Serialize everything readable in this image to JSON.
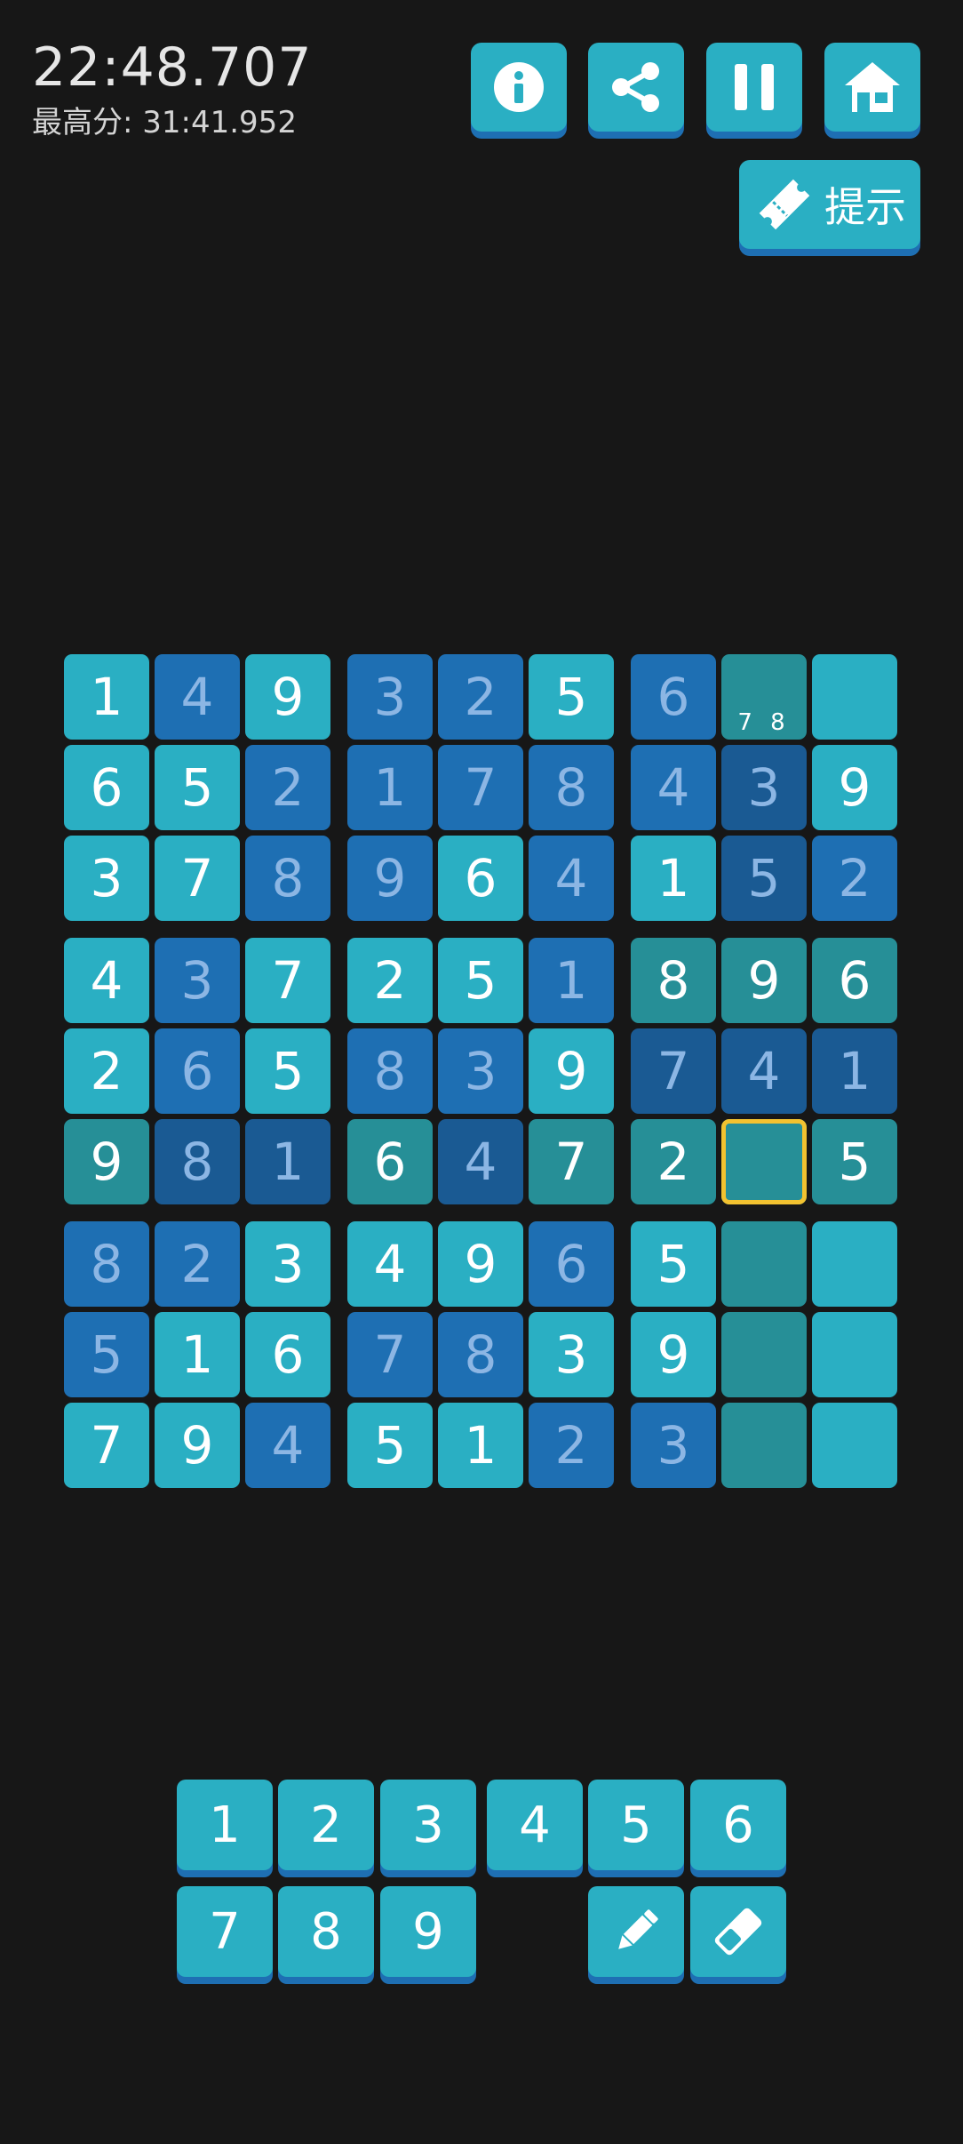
{
  "timer": "22:48.707",
  "best_score": "最高分: 31:41.952",
  "toolbar": {
    "info_icon": "info-circle-icon",
    "share_icon": "share-icon",
    "pause_icon": "pause-icon",
    "home_icon": "home-icon",
    "hint_label": "提示"
  },
  "colors": {
    "given": "#2aafc3",
    "entered": "#1e6fb3",
    "entered_dark": "#1a5a93",
    "highlight": "#268f97",
    "selected_border": "#f2c230",
    "background": "#171717"
  },
  "board": {
    "rows": [
      [
        {
          "v": "1",
          "k": "a"
        },
        {
          "v": "4",
          "k": "b"
        },
        {
          "v": "9",
          "k": "a"
        },
        {
          "v": "3",
          "k": "b"
        },
        {
          "v": "2",
          "k": "b"
        },
        {
          "v": "5",
          "k": "a"
        },
        {
          "v": "6",
          "k": "b"
        },
        {
          "v": "",
          "k": "t",
          "notes": "7 8"
        },
        {
          "v": "",
          "k": "a"
        }
      ],
      [
        {
          "v": "6",
          "k": "a"
        },
        {
          "v": "5",
          "k": "a"
        },
        {
          "v": "2",
          "k": "b"
        },
        {
          "v": "1",
          "k": "b"
        },
        {
          "v": "7",
          "k": "b"
        },
        {
          "v": "8",
          "k": "b"
        },
        {
          "v": "4",
          "k": "b"
        },
        {
          "v": "3",
          "k": "bd"
        },
        {
          "v": "9",
          "k": "a"
        }
      ],
      [
        {
          "v": "3",
          "k": "a"
        },
        {
          "v": "7",
          "k": "a"
        },
        {
          "v": "8",
          "k": "b"
        },
        {
          "v": "9",
          "k": "b"
        },
        {
          "v": "6",
          "k": "a"
        },
        {
          "v": "4",
          "k": "b"
        },
        {
          "v": "1",
          "k": "a"
        },
        {
          "v": "5",
          "k": "bd"
        },
        {
          "v": "2",
          "k": "b"
        }
      ],
      [
        {
          "v": "4",
          "k": "a"
        },
        {
          "v": "3",
          "k": "b"
        },
        {
          "v": "7",
          "k": "a"
        },
        {
          "v": "2",
          "k": "a"
        },
        {
          "v": "5",
          "k": "a"
        },
        {
          "v": "1",
          "k": "b"
        },
        {
          "v": "8",
          "k": "t"
        },
        {
          "v": "9",
          "k": "t"
        },
        {
          "v": "6",
          "k": "t"
        }
      ],
      [
        {
          "v": "2",
          "k": "a"
        },
        {
          "v": "6",
          "k": "b"
        },
        {
          "v": "5",
          "k": "a"
        },
        {
          "v": "8",
          "k": "b"
        },
        {
          "v": "3",
          "k": "b"
        },
        {
          "v": "9",
          "k": "a"
        },
        {
          "v": "7",
          "k": "bd"
        },
        {
          "v": "4",
          "k": "bd"
        },
        {
          "v": "1",
          "k": "bd"
        }
      ],
      [
        {
          "v": "9",
          "k": "t"
        },
        {
          "v": "8",
          "k": "bd"
        },
        {
          "v": "1",
          "k": "bd"
        },
        {
          "v": "6",
          "k": "t"
        },
        {
          "v": "4",
          "k": "bd"
        },
        {
          "v": "7",
          "k": "t"
        },
        {
          "v": "2",
          "k": "t"
        },
        {
          "v": "",
          "k": "t",
          "selected": true
        },
        {
          "v": "5",
          "k": "t"
        }
      ],
      [
        {
          "v": "8",
          "k": "b"
        },
        {
          "v": "2",
          "k": "b"
        },
        {
          "v": "3",
          "k": "a"
        },
        {
          "v": "4",
          "k": "a"
        },
        {
          "v": "9",
          "k": "a"
        },
        {
          "v": "6",
          "k": "b"
        },
        {
          "v": "5",
          "k": "a"
        },
        {
          "v": "",
          "k": "t"
        },
        {
          "v": "",
          "k": "a"
        }
      ],
      [
        {
          "v": "5",
          "k": "b"
        },
        {
          "v": "1",
          "k": "a"
        },
        {
          "v": "6",
          "k": "a"
        },
        {
          "v": "7",
          "k": "b"
        },
        {
          "v": "8",
          "k": "b"
        },
        {
          "v": "3",
          "k": "a"
        },
        {
          "v": "9",
          "k": "a"
        },
        {
          "v": "",
          "k": "t"
        },
        {
          "v": "",
          "k": "a"
        }
      ],
      [
        {
          "v": "7",
          "k": "a"
        },
        {
          "v": "9",
          "k": "a"
        },
        {
          "v": "4",
          "k": "b"
        },
        {
          "v": "5",
          "k": "a"
        },
        {
          "v": "1",
          "k": "a"
        },
        {
          "v": "2",
          "k": "b"
        },
        {
          "v": "3",
          "k": "b"
        },
        {
          "v": "",
          "k": "t"
        },
        {
          "v": "",
          "k": "a"
        }
      ]
    ]
  },
  "keypad": {
    "digits": [
      "1",
      "2",
      "3",
      "4",
      "5",
      "6",
      "7",
      "8",
      "9"
    ],
    "pencil_icon": "pencil-icon",
    "eraser_icon": "eraser-icon"
  }
}
